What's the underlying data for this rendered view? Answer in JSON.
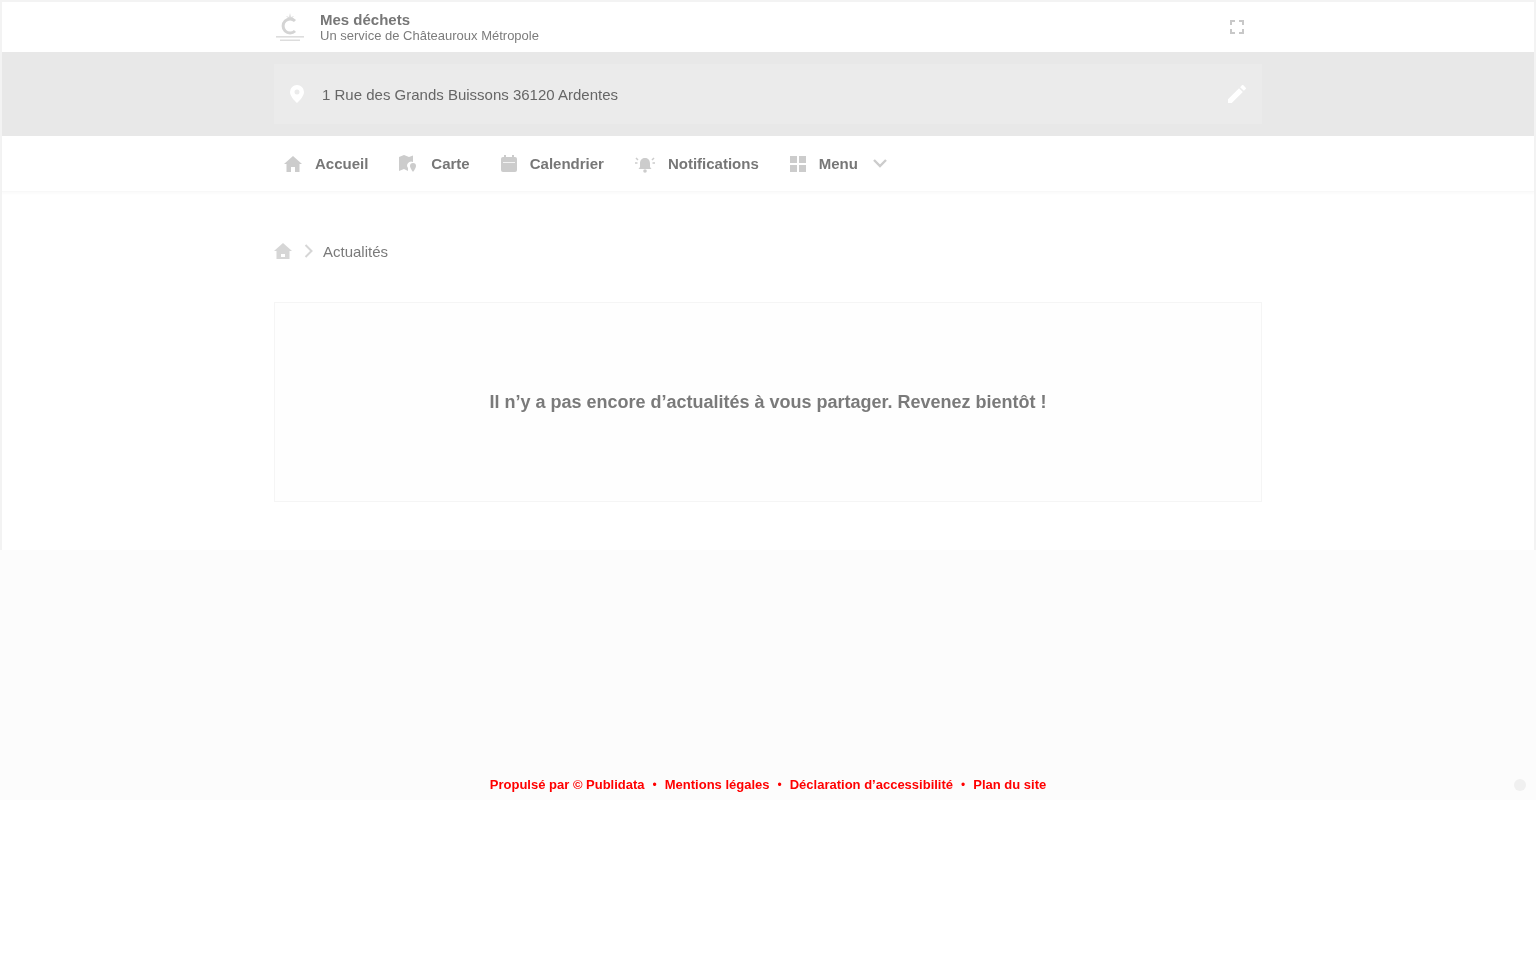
{
  "header": {
    "title": "Mes déchets",
    "subtitle": "Un service de Châteauroux Métropole"
  },
  "address": {
    "value": "1 Rue des Grands Buissons 36120 Ardentes"
  },
  "nav": [
    {
      "kind": "link",
      "label": "Accueil"
    },
    {
      "kind": "link",
      "label": "Carte"
    },
    {
      "kind": "link",
      "label": "Calendrier"
    },
    {
      "kind": "link",
      "label": "Notifications"
    },
    {
      "kind": "dropdown",
      "label": "Menu"
    }
  ],
  "breadcrumb": {
    "current": "Actualités"
  },
  "news": {
    "empty_message": "Il n’y a pas encore d’actualités à vous partager. Revenez bientôt !"
  },
  "footer": {
    "separator": "•",
    "links": [
      "Propulsé par © Publidata",
      "Mentions légales",
      "Déclaration d’accessibilité",
      "Plan du site"
    ]
  }
}
